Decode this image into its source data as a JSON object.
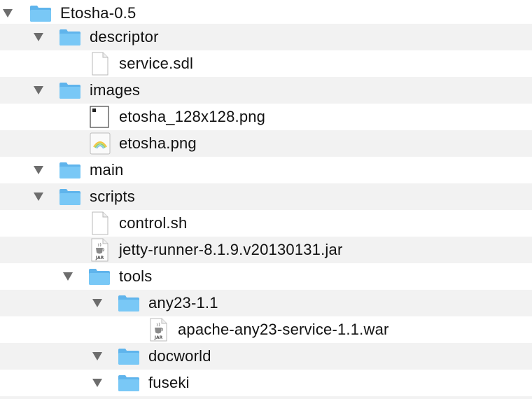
{
  "tree": {
    "rows": [
      {
        "label": "Etosha-0.5",
        "type": "folder",
        "expanded": true
      },
      {
        "label": "descriptor",
        "type": "folder",
        "expanded": true
      },
      {
        "label": "service.sdl",
        "type": "file-blank"
      },
      {
        "label": "images",
        "type": "folder",
        "expanded": true
      },
      {
        "label": "etosha_128x128.png",
        "type": "file-image"
      },
      {
        "label": "etosha.png",
        "type": "file-image-rainbow"
      },
      {
        "label": "main",
        "type": "folder",
        "expanded": true
      },
      {
        "label": "scripts",
        "type": "folder",
        "expanded": true
      },
      {
        "label": "control.sh",
        "type": "file-blank"
      },
      {
        "label": "jetty-runner-8.1.9.v20130131.jar",
        "type": "file-jar"
      },
      {
        "label": "tools",
        "type": "folder",
        "expanded": true
      },
      {
        "label": "any23-1.1",
        "type": "folder",
        "expanded": true
      },
      {
        "label": "apache-any23-service-1.1.war",
        "type": "file-jar"
      },
      {
        "label": "docworld",
        "type": "folder",
        "expanded": true
      },
      {
        "label": "fuseki",
        "type": "folder",
        "expanded": true
      }
    ]
  },
  "icons": {
    "jar_badge": "JAR",
    "folder_color": "#69c0f4",
    "folder_dark": "#4fa7e3"
  }
}
